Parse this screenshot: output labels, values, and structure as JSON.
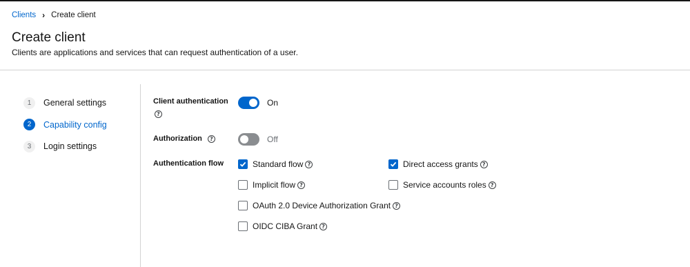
{
  "breadcrumb": {
    "parent": "Clients",
    "current": "Create client"
  },
  "page": {
    "title": "Create client",
    "description": "Clients are applications and services that can request authentication of a user."
  },
  "wizard": {
    "steps": [
      {
        "number": "1",
        "label": "General settings",
        "active": false
      },
      {
        "number": "2",
        "label": "Capability config",
        "active": true
      },
      {
        "number": "3",
        "label": "Login settings",
        "active": false
      }
    ]
  },
  "form": {
    "client_authentication": {
      "label": "Client authentication",
      "state": "On",
      "enabled": true
    },
    "authorization": {
      "label": "Authorization",
      "state": "Off",
      "enabled": false
    },
    "authentication_flow": {
      "label": "Authentication flow",
      "options": [
        {
          "label": "Standard flow",
          "checked": true
        },
        {
          "label": "Direct access grants",
          "checked": true
        },
        {
          "label": "Implicit flow",
          "checked": false
        },
        {
          "label": "Service accounts roles",
          "checked": false
        },
        {
          "label": "OAuth 2.0 Device Authorization Grant",
          "checked": false
        },
        {
          "label": "OIDC CIBA Grant",
          "checked": false
        }
      ]
    }
  },
  "help_icon_glyph": "?",
  "colors": {
    "accent": "#0066cc",
    "toggle_off": "#8a8d90",
    "divider": "#d2d2d2"
  }
}
